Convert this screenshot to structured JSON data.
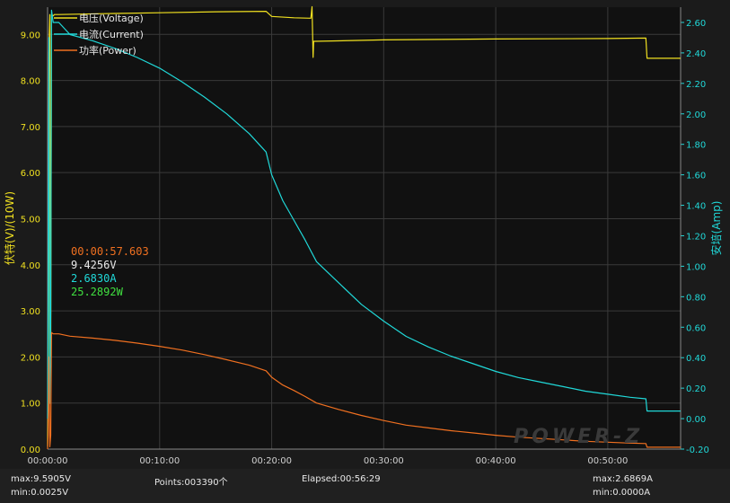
{
  "chart_data": {
    "type": "line",
    "left_axis_label": "伏特(V)/(10W)",
    "right_axis_label": "安培(Amp)",
    "left_ticks": [
      "0.00",
      "1.00",
      "2.00",
      "3.00",
      "4.00",
      "5.00",
      "6.00",
      "7.00",
      "8.00",
      "9.00"
    ],
    "right_ticks": [
      "-0.20",
      "0.00",
      "0.20",
      "0.40",
      "0.60",
      "0.80",
      "1.00",
      "1.20",
      "1.40",
      "1.60",
      "1.80",
      "2.00",
      "2.20",
      "2.40",
      "2.60"
    ],
    "x_ticks": [
      "00:00:00",
      "00:10:00",
      "00:20:00",
      "00:30:00",
      "00:40:00",
      "00:50:00"
    ],
    "x_range_min": [
      0,
      56.5
    ],
    "left_range": [
      0,
      9.59
    ],
    "right_range": [
      -0.2,
      2.7
    ],
    "legend": [
      "电压(Voltage)",
      "电流(Current)",
      "功率(Power)"
    ],
    "legend_placement": "top-left",
    "series": [
      {
        "name": "电压(Voltage)",
        "axis": "left",
        "color": "#f0e020",
        "x": [
          0,
          0.05,
          0.12,
          0.2,
          0.28,
          0.35,
          0.5,
          0.6,
          1.0,
          5,
          10,
          15,
          19.5,
          20,
          22,
          23.5,
          23.6,
          23.7,
          23.75,
          23.8,
          30,
          40,
          50,
          53.4,
          53.5,
          56.5
        ],
        "y": [
          0.05,
          1.0,
          8.6,
          9.43,
          2.0,
          9.43,
          9.4,
          9.43,
          9.43,
          9.45,
          9.47,
          9.49,
          9.5,
          9.39,
          9.36,
          9.35,
          9.6,
          8.5,
          8.85,
          8.85,
          8.88,
          8.9,
          8.91,
          8.92,
          8.48,
          8.48
        ]
      },
      {
        "name": "电流(Current)",
        "axis": "right",
        "color": "#20d8d8",
        "x": [
          0,
          0.05,
          0.12,
          0.2,
          0.28,
          0.35,
          0.5,
          1,
          2,
          4,
          6,
          8,
          10,
          12,
          14,
          16,
          18,
          19.5,
          20,
          21,
          22,
          23,
          24,
          26,
          28,
          30,
          32,
          34,
          36,
          38,
          40,
          42,
          44,
          46,
          48,
          50,
          52,
          53.4,
          53.5,
          56.5
        ],
        "y": [
          0,
          0.8,
          2.5,
          0.1,
          0.7,
          2.68,
          2.6,
          2.6,
          2.52,
          2.48,
          2.43,
          2.37,
          2.3,
          2.21,
          2.11,
          2.0,
          1.87,
          1.75,
          1.6,
          1.43,
          1.3,
          1.17,
          1.03,
          0.89,
          0.75,
          0.64,
          0.54,
          0.47,
          0.41,
          0.36,
          0.31,
          0.27,
          0.24,
          0.21,
          0.18,
          0.16,
          0.14,
          0.13,
          0.05,
          0.05
        ]
      },
      {
        "name": "功率(Power)",
        "axis": "left",
        "color": "#f07020",
        "x": [
          0,
          0.05,
          0.12,
          0.2,
          0.28,
          0.35,
          0.5,
          1,
          2,
          4,
          6,
          8,
          10,
          12,
          14,
          16,
          18,
          19.5,
          20,
          21,
          22,
          23,
          24,
          26,
          28,
          30,
          32,
          34,
          36,
          38,
          40,
          42,
          44,
          46,
          48,
          50,
          52,
          53.4,
          53.5,
          56.5
        ],
        "y": [
          0,
          0.3,
          2.0,
          0.05,
          0.3,
          2.53,
          2.5,
          2.5,
          2.45,
          2.41,
          2.36,
          2.3,
          2.23,
          2.15,
          2.05,
          1.94,
          1.82,
          1.7,
          1.56,
          1.39,
          1.27,
          1.14,
          1.0,
          0.86,
          0.73,
          0.62,
          0.52,
          0.46,
          0.4,
          0.35,
          0.3,
          0.26,
          0.23,
          0.2,
          0.17,
          0.15,
          0.13,
          0.12,
          0.04,
          0.04
        ]
      }
    ]
  },
  "readout": {
    "time": "00:00:57.603",
    "voltage": "9.4256V",
    "current": "2.6830A",
    "power": "25.2892W"
  },
  "colors": {
    "time": "#f07020",
    "voltage": "#e8e8e8",
    "current": "#20d8d8",
    "power": "#40e040"
  },
  "footer": {
    "vmax": "max:9.5905V",
    "vmin": "min:0.0025V",
    "points": "Points:003390个",
    "elapsed": "Elapsed:00:56:29",
    "amax": "max:2.6869A",
    "amin": "min:0.0000A"
  },
  "watermark": "POWER-Z"
}
